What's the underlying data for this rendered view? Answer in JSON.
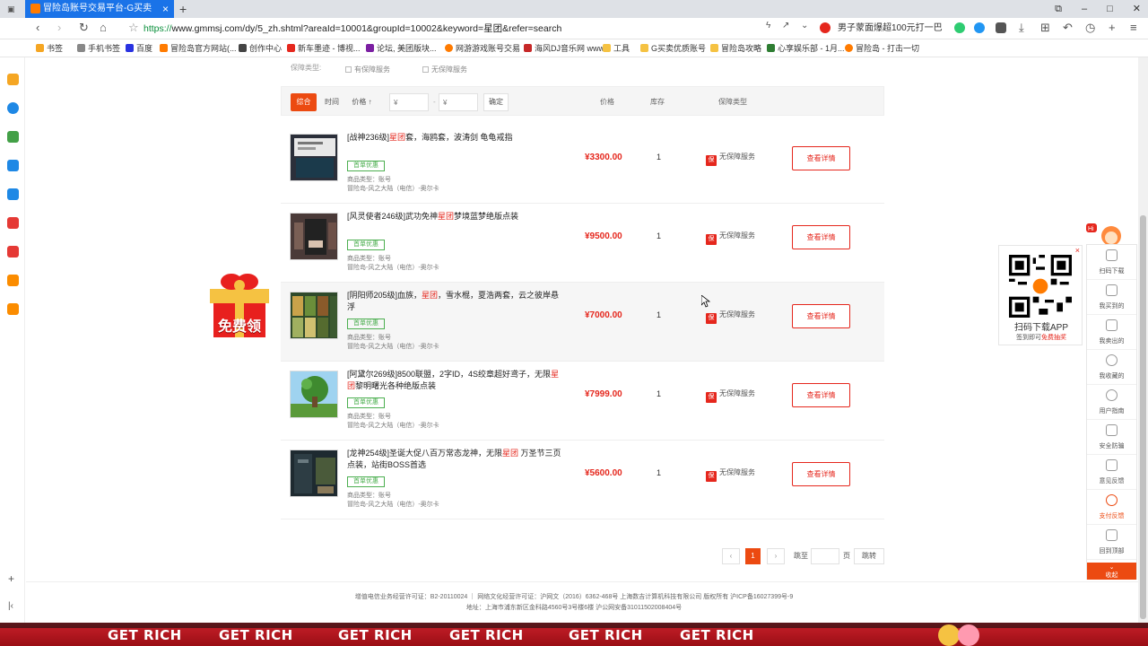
{
  "browser": {
    "tab_title": "冒险岛账号交易平台-G买卖",
    "url_scheme": "https://",
    "url_rest": "www.gmmsj.com/dy/5_zh.shtml?areaId=10001&groupId=10002&keyword=星团&refer=search",
    "ext_text": "男子蒙面爆超100元打一巴",
    "bookmarks": [
      "书签",
      "手机书签",
      "百度",
      "冒险岛官方网站(...",
      "创作中心",
      "新车墨迹 - 博视...",
      "论坛, 美团版块...",
      "网游游戏账号交易",
      "海风DJ音乐网 www...",
      "工具",
      "G买卖优质账号",
      "冒险岛攻略",
      "心享娱乐部 - 1月...",
      "冒险岛 - 打击一切"
    ]
  },
  "filters": {
    "guarantee_label": "保障类型:",
    "options": [
      "有保障服务",
      "无保障服务"
    ]
  },
  "sortbar": {
    "composite": "综合",
    "time": "时间",
    "price": "价格 ↑",
    "min_placeholder": "¥",
    "max_placeholder": "¥",
    "dash": "-",
    "confirm": "确定",
    "col_price": "价格",
    "col_stock": "库存",
    "col_guarantee": "保障类型"
  },
  "listings": [
    {
      "title_pre": "[战神236级]",
      "title_hl": "星团",
      "title_post": "套，海鸥套，波涛剑 龟龟戒指",
      "tag": "首单优惠",
      "type_line": "商品类型：账号",
      "server_line": "冒险岛-风之大陆（电信）-奥尔卡",
      "price": "¥3300.00",
      "qty": "1",
      "guarantee": "无保障服务",
      "detail": "查看详情"
    },
    {
      "title_pre": "[风灵使者246级]武功免神",
      "title_hl": "星团",
      "title_post": "梦境蓝梦绝版点装",
      "tag": "首单优惠",
      "type_line": "商品类型：账号",
      "server_line": "冒险岛-风之大陆（电信）-奥尔卡",
      "price": "¥9500.00",
      "qty": "1",
      "guarantee": "无保障服务",
      "detail": "查看详情"
    },
    {
      "title_pre": "[阴阳师205级]血族，",
      "title_hl": "星团",
      "title_post": "，雪水棍，夏浩两套，云之彼岸悬浮",
      "tag": "首单优惠",
      "type_line": "商品类型：账号",
      "server_line": "冒险岛-风之大陆（电信）-奥尔卡",
      "price": "¥7000.00",
      "qty": "1",
      "guarantee": "无保障服务",
      "detail": "查看详情"
    },
    {
      "title_pre": "[阿黛尔269级]8500联盟，2字ID，4S绞章超好鸢子，无限",
      "title_hl": "星团",
      "title_post": "黎明曙光各种绝版点装",
      "tag": "首单优惠",
      "type_line": "商品类型：账号",
      "server_line": "冒险岛-风之大陆（电信）-奥尔卡",
      "price": "¥7999.00",
      "qty": "1",
      "guarantee": "无保障服务",
      "detail": "查看详情"
    },
    {
      "title_pre": "[龙神254级]圣诞大促八百万常态龙神，无限",
      "title_hl": "星团",
      "title_post": " 万圣节三页点装，站街BOSS首选",
      "tag": "首单优惠",
      "type_line": "商品类型：账号",
      "server_line": "冒险岛-风之大陆（电信）-奥尔卡",
      "price": "¥5600.00",
      "qty": "1",
      "guarantee": "无保障服务",
      "detail": "查看详情"
    }
  ],
  "pager": {
    "prev": "‹",
    "current": "1",
    "next": "›",
    "goto_label": "跳至",
    "page_unit": "页",
    "goto_btn": "跳转"
  },
  "footer": {
    "line1": "增值电信业务经营许可证：B2-20110024 ｜ 网络文化经营许可证：沪网文（2016）6362-468号 上海数吉计算机科技有限公司 版权所有 沪ICP备16027399号-9",
    "line2": "地址：上海市浦东新区金科路4560号3号楼6楼    沪公网安备31011502008404号"
  },
  "gift": {
    "label": "免费领"
  },
  "qr": {
    "title": "扫码下载APP",
    "sub_pre": "签到即可",
    "sub_hl": "免费抽奖"
  },
  "rightbar": {
    "items": [
      "扫码下载",
      "我买到的",
      "我卖出的",
      "我收藏的",
      "用户指南",
      "安全防骗",
      "意见反馈",
      "支付反馈",
      "回到顶部"
    ],
    "collapse": "收起"
  },
  "banner": {
    "slogan": "GET RICH"
  },
  "colors": {
    "accent": "#ec4a11",
    "price": "#e5271d",
    "tag": "#4caf50",
    "tab": "#1a73e8"
  }
}
